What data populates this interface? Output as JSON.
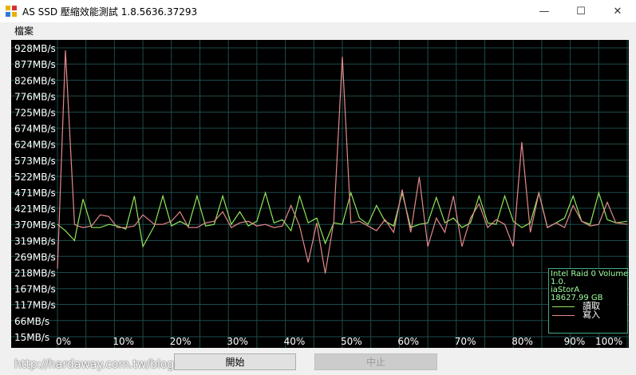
{
  "window": {
    "title": "AS SSD 壓縮效能測試 1.8.5636.37293",
    "minimize_glyph": "—",
    "maximize_glyph": "☐",
    "close_glyph": "✕"
  },
  "menu": {
    "file_label": "檔案"
  },
  "chart_data": {
    "type": "line",
    "y_tick_labels": [
      "928MB/s",
      "877MB/s",
      "826MB/s",
      "776MB/s",
      "725MB/s",
      "674MB/s",
      "624MB/s",
      "573MB/s",
      "522MB/s",
      "471MB/s",
      "421MB/s",
      "370MB/s",
      "319MB/s",
      "269MB/s",
      "218MB/s",
      "167MB/s",
      "117MB/s",
      "66MB/s",
      "15MB/s"
    ],
    "y_tick_values": [
      928,
      877,
      826,
      776,
      725,
      674,
      624,
      573,
      522,
      471,
      421,
      370,
      319,
      269,
      218,
      167,
      117,
      66,
      15
    ],
    "x_tick_labels": [
      "0%",
      "10%",
      "20%",
      "30%",
      "40%",
      "50%",
      "60%",
      "70%",
      "80%",
      "90%",
      "100%"
    ],
    "ylim": [
      15,
      928
    ],
    "xlim": [
      0,
      100
    ],
    "grid": true,
    "x": [
      0,
      1.4,
      3,
      3.5,
      4.5,
      6,
      7.5,
      9,
      10.5,
      12,
      13.5,
      15,
      17,
      18.5,
      20,
      21.5,
      23,
      24.5,
      26,
      27.5,
      29,
      30.5,
      32,
      33.5,
      35,
      36.5,
      38,
      39.5,
      41,
      42.5,
      44,
      45.5,
      47,
      48.5,
      50,
      51.5,
      53,
      54.5,
      56,
      57.5,
      59,
      60.5,
      62,
      63.5,
      65,
      66.5,
      68,
      69.5,
      71,
      72.5,
      74,
      75.5,
      77,
      78.5,
      80,
      81.5,
      83,
      84.5,
      86,
      87.5,
      89,
      90.5,
      92,
      93.5,
      95,
      96.5,
      98,
      100
    ],
    "series": [
      {
        "name": "讀取",
        "color": "#8fe65a",
        "values": [
          370,
          350,
          319,
          365,
          450,
          360,
          360,
          370,
          365,
          355,
          460,
          300,
          365,
          460,
          365,
          380,
          365,
          460,
          365,
          370,
          460,
          370,
          410,
          365,
          380,
          470,
          375,
          385,
          350,
          460,
          375,
          390,
          310,
          375,
          370,
          470,
          390,
          370,
          430,
          380,
          365,
          470,
          360,
          370,
          375,
          455,
          375,
          390,
          360,
          375,
          460,
          375,
          370,
          460,
          380,
          360,
          375,
          470,
          360,
          375,
          390,
          460,
          380,
          370,
          470,
          385,
          375,
          380
        ]
      },
      {
        "name": "寫入",
        "color": "#e6898c",
        "values": [
          230,
          920,
          370,
          365,
          360,
          365,
          400,
          395,
          360,
          360,
          365,
          400,
          370,
          370,
          380,
          410,
          360,
          360,
          375,
          380,
          410,
          360,
          375,
          380,
          365,
          370,
          360,
          365,
          430,
          365,
          250,
          375,
          215,
          380,
          900,
          375,
          380,
          365,
          350,
          385,
          345,
          480,
          345,
          520,
          300,
          390,
          345,
          460,
          300,
          390,
          435,
          360,
          385,
          370,
          300,
          630,
          345,
          470,
          360,
          375,
          360,
          430,
          380,
          365,
          370,
          440,
          375,
          370
        ]
      }
    ]
  },
  "legend": {
    "drive_line1": "Intel Raid 0 Volume",
    "drive_line2": "1.0.",
    "drive_line3": "iaStorA",
    "drive_line4": "18627.99 GB",
    "read_label": "讀取",
    "write_label": "寫入",
    "read_color": "#8fe65a",
    "write_color": "#e6898c"
  },
  "buttons": {
    "start_label": "開始",
    "stop_label": "中止"
  },
  "watermark": "http://hardaway.com.tw/blog"
}
